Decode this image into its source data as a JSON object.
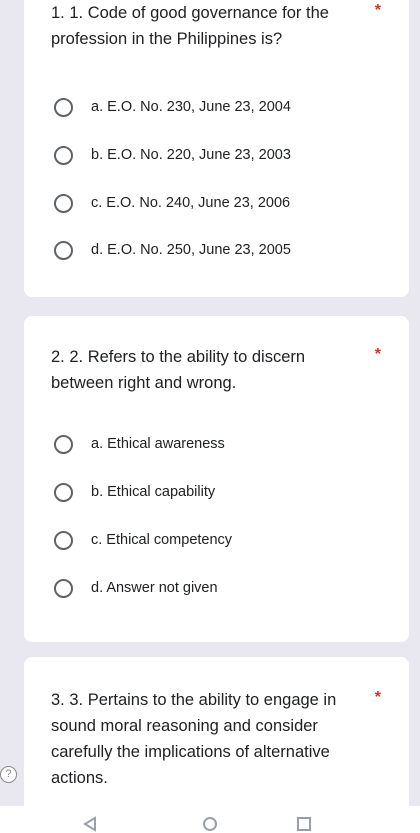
{
  "questions": [
    {
      "text": "1. 1. Code of good governance for the profession in the Philippines is?",
      "required_mark": "*",
      "options": [
        "a. E.O. No. 230, June 23, 2004",
        "b. E.O. No. 220, June 23, 2003",
        "c. E.O. No. 240, June 23, 2006",
        "d. E.O. No. 250, June 23, 2005"
      ]
    },
    {
      "text": "2. 2. Refers to the ability to discern between right and wrong.",
      "required_mark": "*",
      "options": [
        "a. Ethical awareness",
        "b. Ethical capability",
        "c. Ethical competency",
        "d. Answer not given"
      ]
    },
    {
      "text": "3. 3. Pertains to the ability to engage in sound moral reasoning and consider carefully the implications of alternative actions.",
      "required_mark": "*"
    }
  ],
  "help_icon": "?",
  "navbar": {
    "icons": [
      "back-icon",
      "home-icon",
      "recents-icon"
    ]
  },
  "colors": {
    "background": "#e9e8f0",
    "card": "#ffffff",
    "required": "#d93025",
    "radio_border": "#5f6368"
  }
}
